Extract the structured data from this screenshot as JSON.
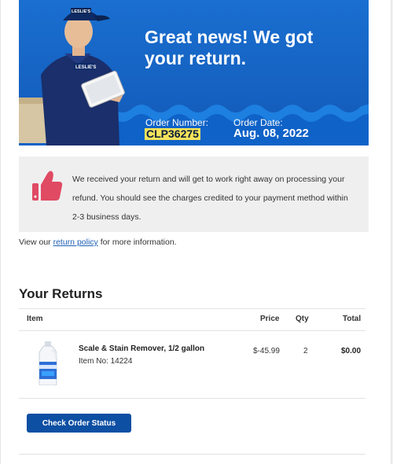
{
  "hero": {
    "title": "Great news! We got your return.",
    "order_number_label": "Order Number:",
    "order_number": "CLP36275",
    "order_date_label": "Order Date:",
    "order_date": "Aug. 08, 2022",
    "brand_cap_text": "LESLIE'S",
    "brand_shirt_text": "LESLIE'S",
    "bg_color": "#1565c8"
  },
  "info": {
    "icon": "thumbs-up-icon",
    "message": "We received your return and will get to work right away on processing your refund. You should see the charges credited to your payment method within 2-3 business days."
  },
  "policy": {
    "prefix": "View our",
    "link_text": "return policy",
    "suffix": "for more information."
  },
  "returns": {
    "title": "Your Returns",
    "headers": {
      "item": "Item",
      "price": "Price",
      "qty": "Qty",
      "total": "Total"
    },
    "items": [
      {
        "name": "Scale & Stain Remover, 1/2 gallon",
        "item_no": "Item No: 14224",
        "price": "$-45.99",
        "qty": "2",
        "total": "$0.00"
      }
    ]
  },
  "cta": {
    "label": "Check Order Status",
    "color": "#0c4fa3"
  }
}
